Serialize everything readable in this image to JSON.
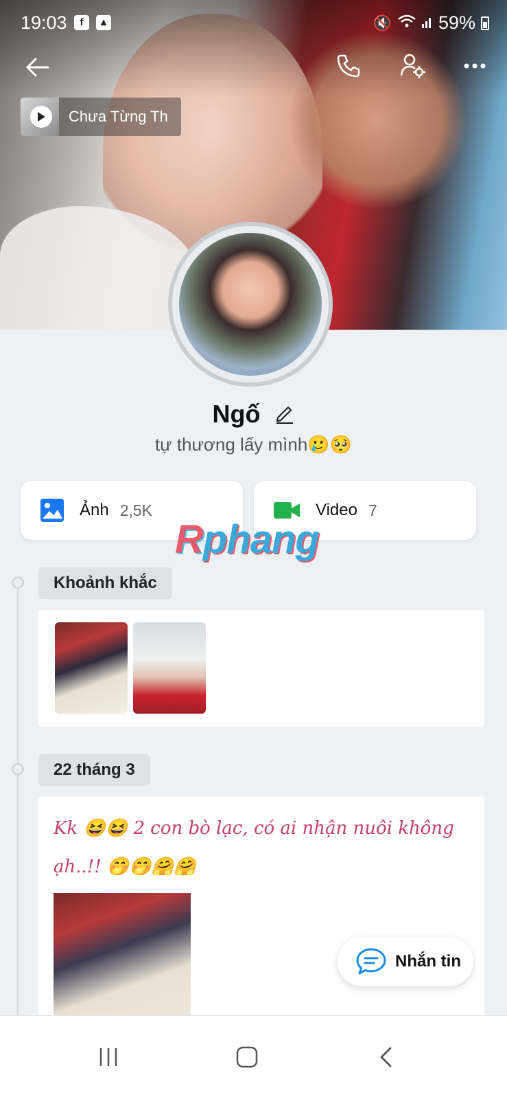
{
  "status_bar": {
    "time": "19:03",
    "app_icons": [
      "facebook-icon",
      "gallery-icon"
    ],
    "battery": "59%"
  },
  "header": {
    "music_title": "Chưa Từng Th"
  },
  "profile": {
    "name": "Ngố",
    "bio": "tự thương lấy mình🥲🥺"
  },
  "media": {
    "photos": {
      "label": "Ảnh",
      "count": "2,5K",
      "color": "#1877f2"
    },
    "videos": {
      "label": "Video",
      "count": "7",
      "color": "#22b14c"
    }
  },
  "watermark": {
    "part1": "R",
    "part2": "phang"
  },
  "timeline": {
    "moments_label": "Khoảnh khắc",
    "date_label": "22 tháng 3",
    "post_text": "Kk 😆😆 2 con bò lạc, có ai nhận nuôi không ạh..!! 🤭🤭🤗🤗"
  },
  "actions": {
    "message_label": "Nhắn tin"
  },
  "navbar": {
    "recents": "recents-icon",
    "home": "home-icon",
    "back": "back-icon"
  }
}
